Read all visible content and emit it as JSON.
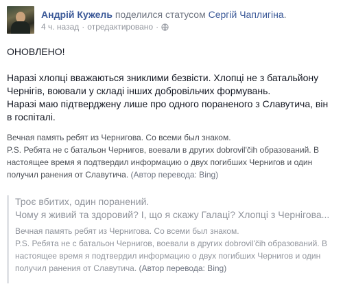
{
  "header": {
    "author": "Андрій Кужель",
    "action": "поделился статусом",
    "target": "Сергій Чаплигіна",
    "period": ".",
    "time": "4 ч. назад",
    "separator": "·",
    "edited": "отредактировано",
    "privacy_icon": "globe-icon"
  },
  "post": {
    "updated": "ОНОВЛЕНО!",
    "p1": "Наразі хлопці вважаються зниклими безвісти. Хлопці не з батальйону Чернігів, воювали у складі інших добровільчих формувань.",
    "p2": "Наразі маю підтверджену лише про одного пораненого з Славутича, він в госпіталі."
  },
  "translation": {
    "line1": "Вечная память ребят из Чернигова. Со всеми был знаком.",
    "line2": "P.S. Ребята не с батальон Чернигов, воевали в других dobrovil'čih образований. В настоящее время я подтвердил информацию о двух погибших Чернигов и один получил ранения от Славутича.",
    "credit": "(Автор перевода: Bing)"
  },
  "shared": {
    "line1": "Троє вбитих, один поранений.",
    "line2": "Чому я живий та здоровий? І, що я скажу Галаці? Хлопці з Чернігова...",
    "tr_line1": "Вечная память ребят из Чернигова. Со всеми был знаком.",
    "tr_line2": "P.S. Ребята не с батальон Чернигов, воевали в других dobrovil'čih образований. В настоящее время я подтвердил информацию о двух погибших Чернигов и один получил ранения от Славутича.",
    "tr_credit": "(Автор перевода: Bing)"
  },
  "colors": {
    "link": "#3b5998",
    "meta": "#90949c",
    "text": "#141823"
  }
}
